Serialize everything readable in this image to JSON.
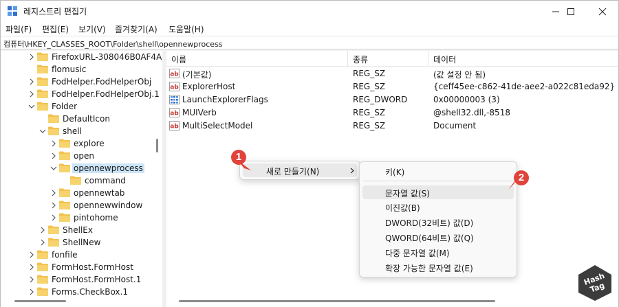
{
  "window": {
    "title": "레지스트리 편집기",
    "controls": {
      "minimize": "minimize-icon",
      "maximize": "maximize-icon",
      "close": "close-icon"
    }
  },
  "menu": [
    "파일(F)",
    "편집(E)",
    "보기(V)",
    "즐겨찾기(A)",
    "도움말(H)"
  ],
  "address": "컴퓨터\\HKEY_CLASSES_ROOT\\Folder\\shell\\opennewprocess",
  "tree": [
    {
      "label": "FirefoxURL-308046B0AF4A",
      "expand": "right"
    },
    {
      "label": "flomusic",
      "expand": "none"
    },
    {
      "label": "FodHelper.FodHelperObj",
      "expand": "right"
    },
    {
      "label": "FodHelper.FodHelperObj.1",
      "expand": "right"
    },
    {
      "label": "Folder",
      "expand": "down"
    },
    {
      "label": "DefaultIcon",
      "expand": "none"
    },
    {
      "label": "shell",
      "expand": "down"
    },
    {
      "label": "explore",
      "expand": "right"
    },
    {
      "label": "open",
      "expand": "right"
    },
    {
      "label": "opennewprocess",
      "expand": "down",
      "selected": true
    },
    {
      "label": "command",
      "expand": "none"
    },
    {
      "label": "opennewtab",
      "expand": "right"
    },
    {
      "label": "opennewwindow",
      "expand": "right"
    },
    {
      "label": "pintohome",
      "expand": "right"
    },
    {
      "label": "ShellEx",
      "expand": "right"
    },
    {
      "label": "ShellNew",
      "expand": "right"
    },
    {
      "label": "fonfile",
      "expand": "right"
    },
    {
      "label": "FormHost.FormHost",
      "expand": "right"
    },
    {
      "label": "FormHost.FormHost.1",
      "expand": "right"
    },
    {
      "label": "Forms.CheckBox.1",
      "expand": "right"
    }
  ],
  "columns": {
    "name": "이름",
    "type": "종류",
    "data": "데이터"
  },
  "values": [
    {
      "icon": "string-value-icon",
      "name": "(기본값)",
      "type": "REG_SZ",
      "data": "(값 설정 안 됨)"
    },
    {
      "icon": "string-value-icon",
      "name": "ExplorerHost",
      "type": "REG_SZ",
      "data": "{ceff45ee-c862-41de-aee2-a022c81eda92}"
    },
    {
      "icon": "binary-value-icon",
      "name": "LaunchExplorerFlags",
      "type": "REG_DWORD",
      "data": "0x00000003 (3)"
    },
    {
      "icon": "string-value-icon",
      "name": "MUIVerb",
      "type": "REG_SZ",
      "data": "@shell32.dll,-8518"
    },
    {
      "icon": "string-value-icon",
      "name": "MultiSelectModel",
      "type": "REG_SZ",
      "data": "Document"
    }
  ],
  "context_menu": {
    "new_item": "새로 만들기(N)",
    "submenu": [
      "키(K)",
      "문자열 값(S)",
      "이진값(B)",
      "DWORD(32비트) 값(D)",
      "QWORD(64비트) 값(Q)",
      "다중 문자열 값(M)",
      "확장 가능한 문자열 값(E)"
    ]
  },
  "badges": [
    "1",
    "2"
  ],
  "watermark": {
    "line1": "Hash",
    "line2": "Tag"
  },
  "colors": {
    "badge": "#e0433a",
    "selection": "#cce4f7",
    "folder": "#f2c14e"
  }
}
